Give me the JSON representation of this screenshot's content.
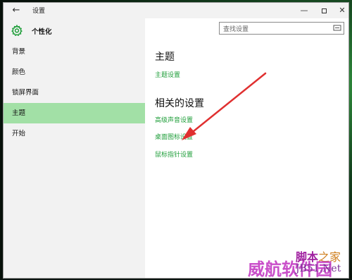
{
  "window": {
    "title": "设置",
    "back_glyph": "←",
    "minimize_glyph": "—",
    "close_glyph": "✕"
  },
  "sidebar": {
    "section_title": "个性化",
    "items": [
      {
        "label": "背景"
      },
      {
        "label": "颜色"
      },
      {
        "label": "锁屏界面"
      },
      {
        "label": "主题",
        "selected": true
      },
      {
        "label": "开始"
      }
    ]
  },
  "search": {
    "placeholder": "查找设置",
    "icon": "search-icon"
  },
  "main": {
    "heading": "主题",
    "theme_settings_link": "主题设置",
    "related_heading": "相关的设置",
    "related_links": [
      {
        "label": "高级声音设置"
      },
      {
        "label": "桌面图标设置"
      },
      {
        "label": "鼠标指针设置"
      }
    ]
  },
  "watermark": {
    "top_left": "脚本",
    "top_right": "之家",
    "main": "威航软件园",
    "sub": "JB51.Net"
  },
  "colors": {
    "accent": "#1f9e3a",
    "selected_bg": "#a2e0a6",
    "annotation_arrow": "#e03030"
  }
}
